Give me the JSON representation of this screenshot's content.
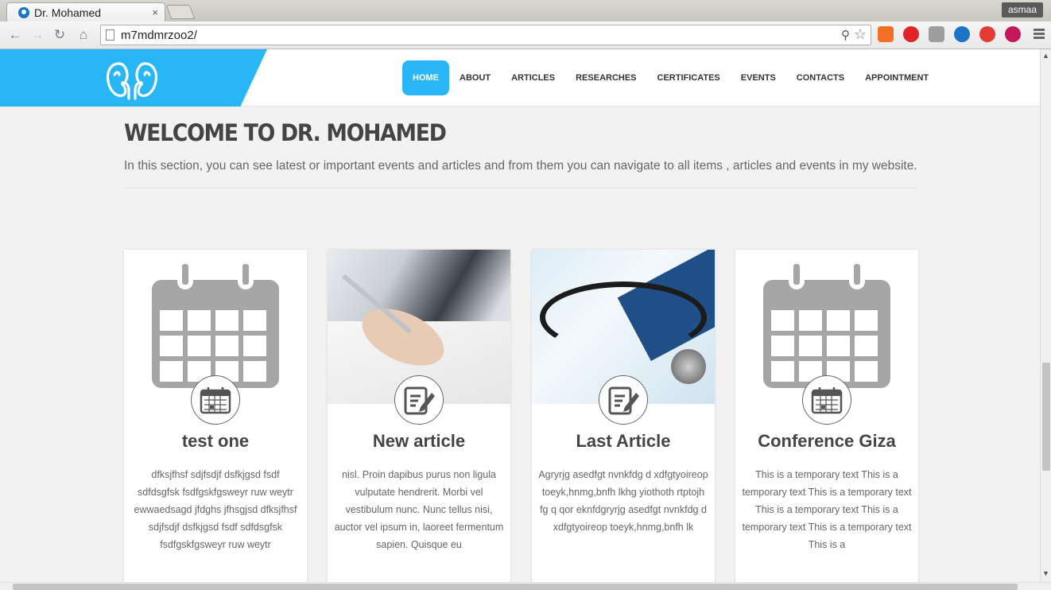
{
  "browser": {
    "tab_title": "Dr. Mohamed",
    "tab_close": "×",
    "user_name": "asmaa",
    "url": "m7mdmrzoo2/",
    "zoom_icon": "⚲",
    "star_icon": "☆",
    "back_icon": "←",
    "forward_icon": "→",
    "reload_icon": "↻",
    "home_icon": "⌂",
    "extensions": [
      {
        "name": "soundcloud-icon",
        "color": "#f26f23"
      },
      {
        "name": "opera-icon",
        "color": "#e0242a"
      },
      {
        "name": "extension-puzzle-icon",
        "color": "#9e9e9e"
      },
      {
        "name": "drupal-icon",
        "color": "#1a73c7"
      },
      {
        "name": "adblock-icon",
        "color": "#e53935"
      },
      {
        "name": "flower-icon",
        "color": "#c2185b"
      }
    ]
  },
  "nav": {
    "items": [
      "HOME",
      "ABOUT",
      "ARTICLES",
      "RESEARCHES",
      "CERTIFICATES",
      "EVENTS",
      "CONTACTS",
      "APPOINTMENT"
    ],
    "active_index": 0
  },
  "welcome": {
    "title": "WELCOME TO DR. MOHAMED",
    "subtitle": "In this section, you can see latest or important events and articles and from them you can navigate to all items , articles and events in my website."
  },
  "cards": [
    {
      "title": "test one",
      "type": "event",
      "text": "dfksjfhsf sdjfsdjf dsfkjgsd fsdf sdfdsgfsk fsdfgskfgsweyr ruw weytr ewwaedsagd jfdghs jfhsgjsd dfksjfhsf sdjfsdjf dsfkjgsd fsdf sdfdsgfsk fsdfgskfgsweyr ruw weytr"
    },
    {
      "title": "New article",
      "type": "article",
      "text": "nisl. Proin dapibus purus non ligula vulputate hendrerit. Morbi vel vestibulum nunc. Nunc tellus nisi, auctor vel ipsum in, laoreet fermentum sapien. Quisque eu"
    },
    {
      "title": "Last Article",
      "type": "article",
      "text": "Agryrjg asedfgt nvnkfdg d xdfgtyoireop toeyk,hnmg,bnfh lkhg yiothoth rtptojh fg q qor eknfdgryrjg asedfgt nvnkfdg d xdfgtyoireop toeyk,hnmg,bnfh lk"
    },
    {
      "title": "Conference Giza",
      "type": "event",
      "text": "This is a temporary text This is a temporary text This is a temporary text This is a temporary text This is a temporary text This is a temporary text This is a"
    }
  ],
  "colors": {
    "accent": "#29b6f6",
    "heading": "#444444",
    "body_text": "#666666"
  }
}
